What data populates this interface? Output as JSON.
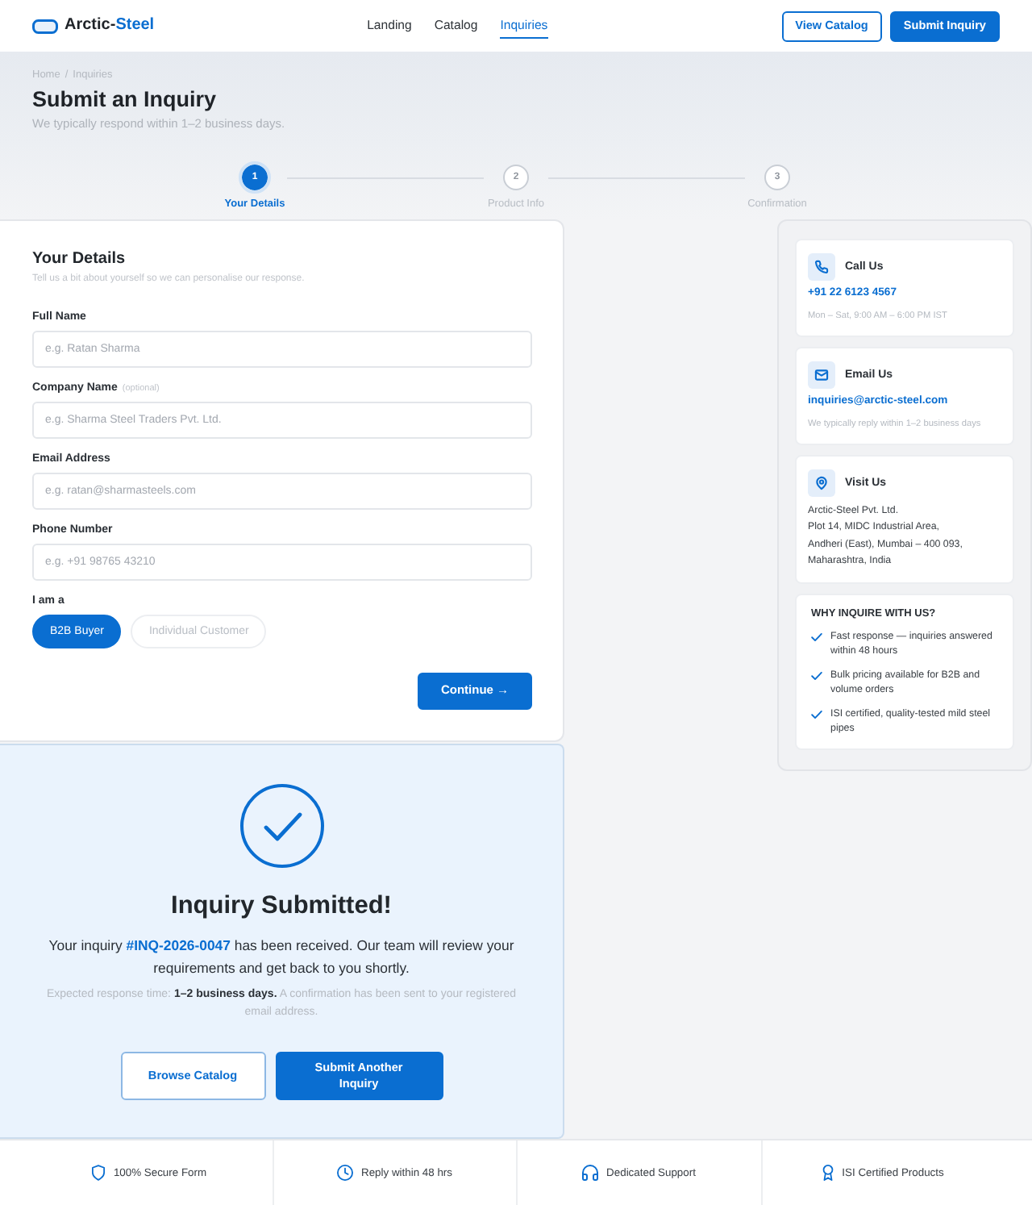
{
  "header": {
    "logo": {
      "text": "Arctic-",
      "accent": "Steel"
    },
    "nav": [
      {
        "label": "Landing",
        "selected": false
      },
      {
        "label": "Catalog",
        "selected": false
      },
      {
        "label": "Inquiries",
        "selected": true
      }
    ],
    "buttons": [
      {
        "label": "View Catalog",
        "kind": "outline"
      },
      {
        "label": "Submit Inquiry",
        "kind": "primary"
      }
    ]
  },
  "breadcrumb": {
    "items": [
      "Home",
      "Inquiries"
    ],
    "separator": "/"
  },
  "page_title": "Submit an Inquiry",
  "page_subtitle": "We typically respond within 1–2 business days.",
  "steps": [
    {
      "number": "1",
      "label": "Your Details",
      "selected": true
    },
    {
      "number": "2",
      "label": "Product Info",
      "selected": false
    },
    {
      "number": "3",
      "label": "Confirmation",
      "selected": false
    }
  ],
  "form": {
    "title": "Your Details",
    "subtitle": "Tell us a bit about yourself so we can personalise our response.",
    "fields": [
      {
        "label": "Full Name",
        "placeholder": "e.g. Ratan Sharma"
      },
      {
        "label": "Company Name",
        "note": "(optional)",
        "placeholder": "e.g. Sharma Steel Traders Pvt. Ltd."
      },
      {
        "label": "Email Address",
        "placeholder": "e.g. ratan@sharmasteels.com"
      },
      {
        "label": "Phone Number",
        "placeholder": "e.g. +91 98765 43210"
      }
    ],
    "role": {
      "label": "I am a",
      "options": [
        {
          "label": "B2B Buyer",
          "selected": true
        },
        {
          "label": "Individual Customer",
          "selected": false
        }
      ]
    },
    "continue_label": "Continue →"
  },
  "success": {
    "title": "Inquiry Submitted!",
    "message": "Your inquiry **#INQ-2026-0047** has been received. Our team will review your requirements and get back to you shortly.",
    "note": "Expected response time: **1–2 business days.** A confirmation has been sent to your registered email address.",
    "buttons": [
      {
        "label": "Browse Catalog",
        "kind": "outline"
      },
      {
        "label": "Submit Another Inquiry",
        "kind": "primary"
      }
    ]
  },
  "contact_cards": [
    {
      "kind": "phone",
      "title": "Call Us",
      "value": "+91 22 6123 4567",
      "note": "Mon – Sat, 9:00 AM – 6:00 PM IST"
    },
    {
      "kind": "email",
      "title": "Email Us",
      "value": "inquiries@arctic-steel.com",
      "note": "We typically reply within 1–2 business days"
    },
    {
      "kind": "location",
      "title": "Visit Us",
      "address_lines": [
        "Arctic-Steel Pvt. Ltd.",
        "Plot 14, MIDC Industrial Area,",
        "Andheri (East), Mumbai – 400 093,",
        "Maharashtra, India"
      ]
    }
  ],
  "benefits": {
    "title": "WHY INQUIRE WITH US?",
    "items": [
      "Fast response — inquiries answered within 48 hours",
      "Bulk pricing available for B2B and volume orders",
      "ISI certified, quality-tested mild steel pipes"
    ]
  },
  "footer_features": [
    {
      "kind": "shield",
      "label": "100% Secure Form"
    },
    {
      "kind": "clock",
      "label": "Reply within 48 hrs"
    },
    {
      "kind": "headset",
      "label": "Dedicated Support"
    },
    {
      "kind": "award",
      "label": "ISI Certified Products"
    }
  ]
}
